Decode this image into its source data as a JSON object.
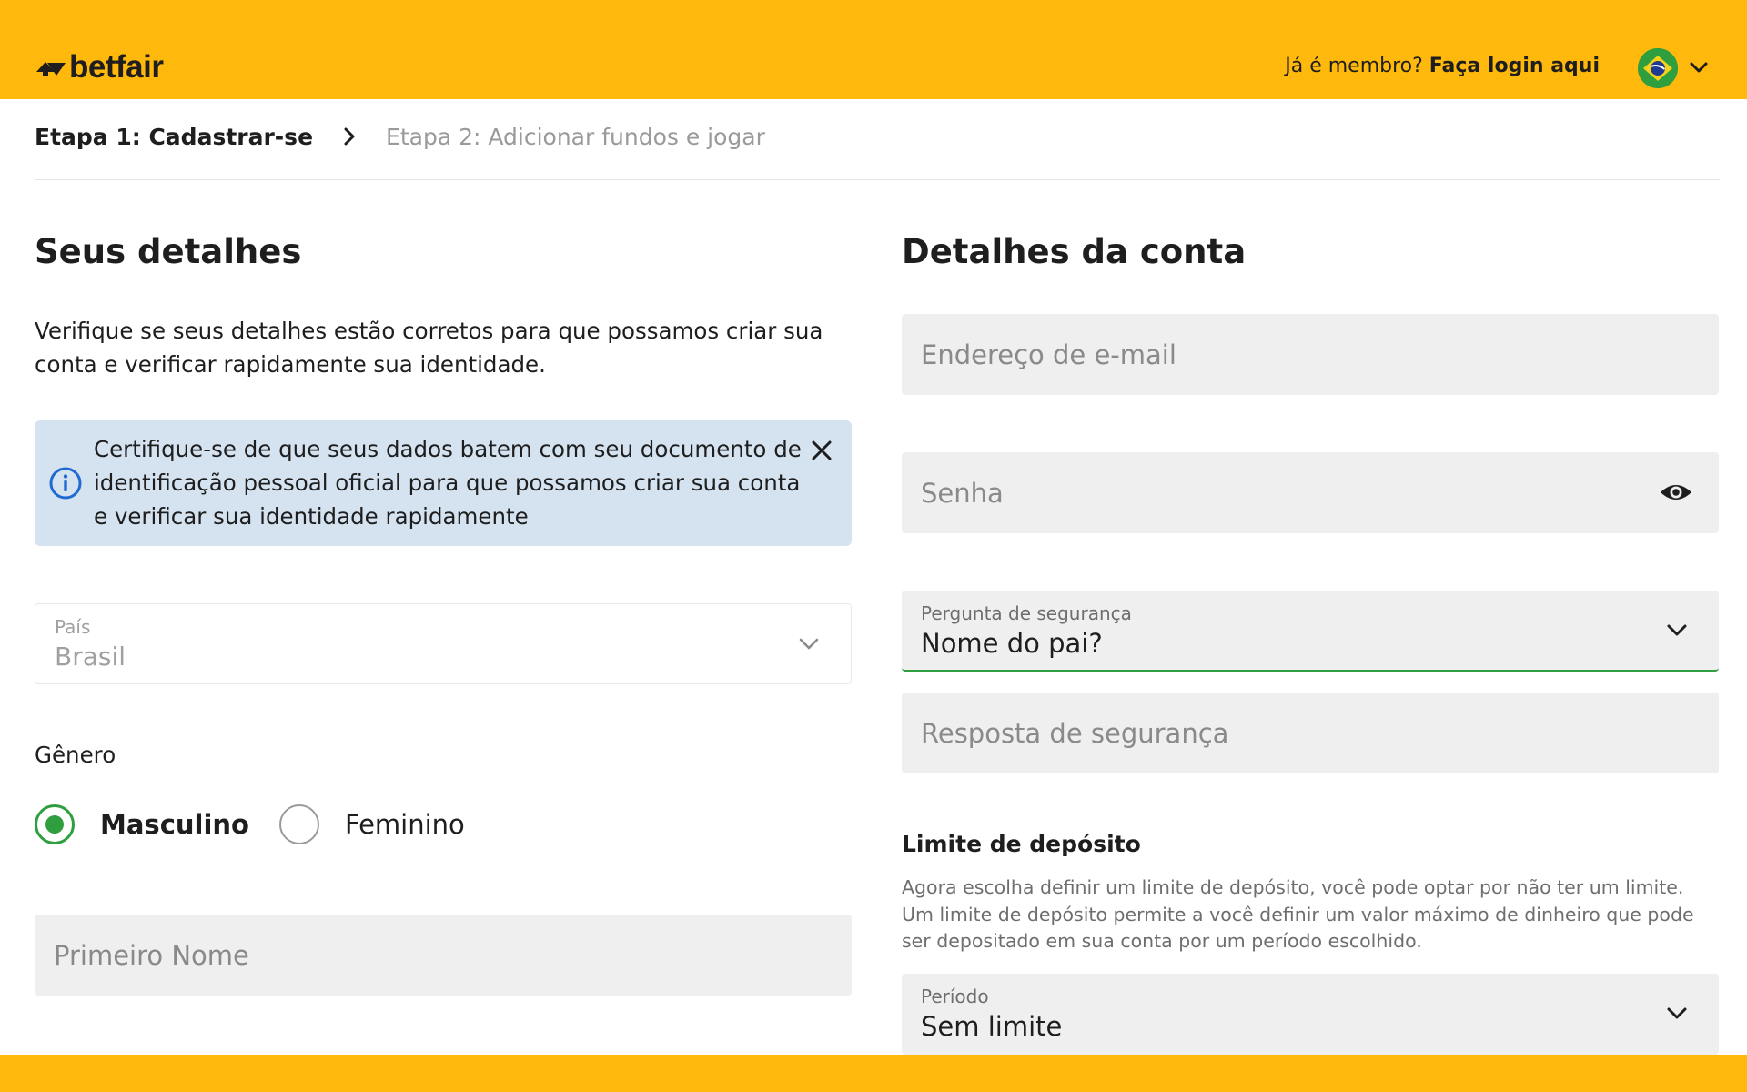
{
  "header": {
    "brand": "betfair",
    "member_question": "Já é membro?",
    "login_link": "Faça login aqui",
    "country_flag_icon": "brazil-flag-icon",
    "colors": {
      "brand_yellow": "#ffb80c"
    }
  },
  "breadcrumb": {
    "step1": "Etapa 1: Cadastrar-se",
    "step2": "Etapa 2: Adicionar fundos e jogar"
  },
  "your_details": {
    "title": "Seus detalhes",
    "intro": "Verifique se seus detalhes estão corretos para que possamos criar sua conta e verificar rapidamente sua identidade.",
    "alert": {
      "text": "Certifique-se de que seus dados batem com seu documento de identificação pessoal oficial para que possamos criar sua conta e verificar sua identidade rapidamente",
      "icon": "info-icon",
      "close_icon": "close-icon"
    },
    "country": {
      "label": "País",
      "value": "Brasil"
    },
    "gender": {
      "label": "Gênero",
      "options": [
        {
          "label": "Masculino",
          "checked": true
        },
        {
          "label": "Feminino",
          "checked": false
        }
      ]
    },
    "first_name": {
      "placeholder": "Primeiro Nome",
      "value": ""
    }
  },
  "account_details": {
    "title": "Detalhes da conta",
    "email": {
      "placeholder": "Endereço de e-mail",
      "value": ""
    },
    "password": {
      "placeholder": "Senha",
      "value": "",
      "toggle_icon": "eye-icon"
    },
    "security_question": {
      "label": "Pergunta de segurança",
      "value": "Nome do pai?"
    },
    "security_answer": {
      "placeholder": "Resposta de segurança",
      "value": ""
    },
    "deposit_limit": {
      "title": "Limite de depósito",
      "help": "Agora escolha definir um limite de depósito, você pode optar por não ter um limite. Um limite de depósito permite a você definir um valor máximo de dinheiro que pode ser depositado em sua conta por um período escolhido.",
      "period": {
        "label": "Período",
        "value": "Sem limite"
      }
    }
  }
}
